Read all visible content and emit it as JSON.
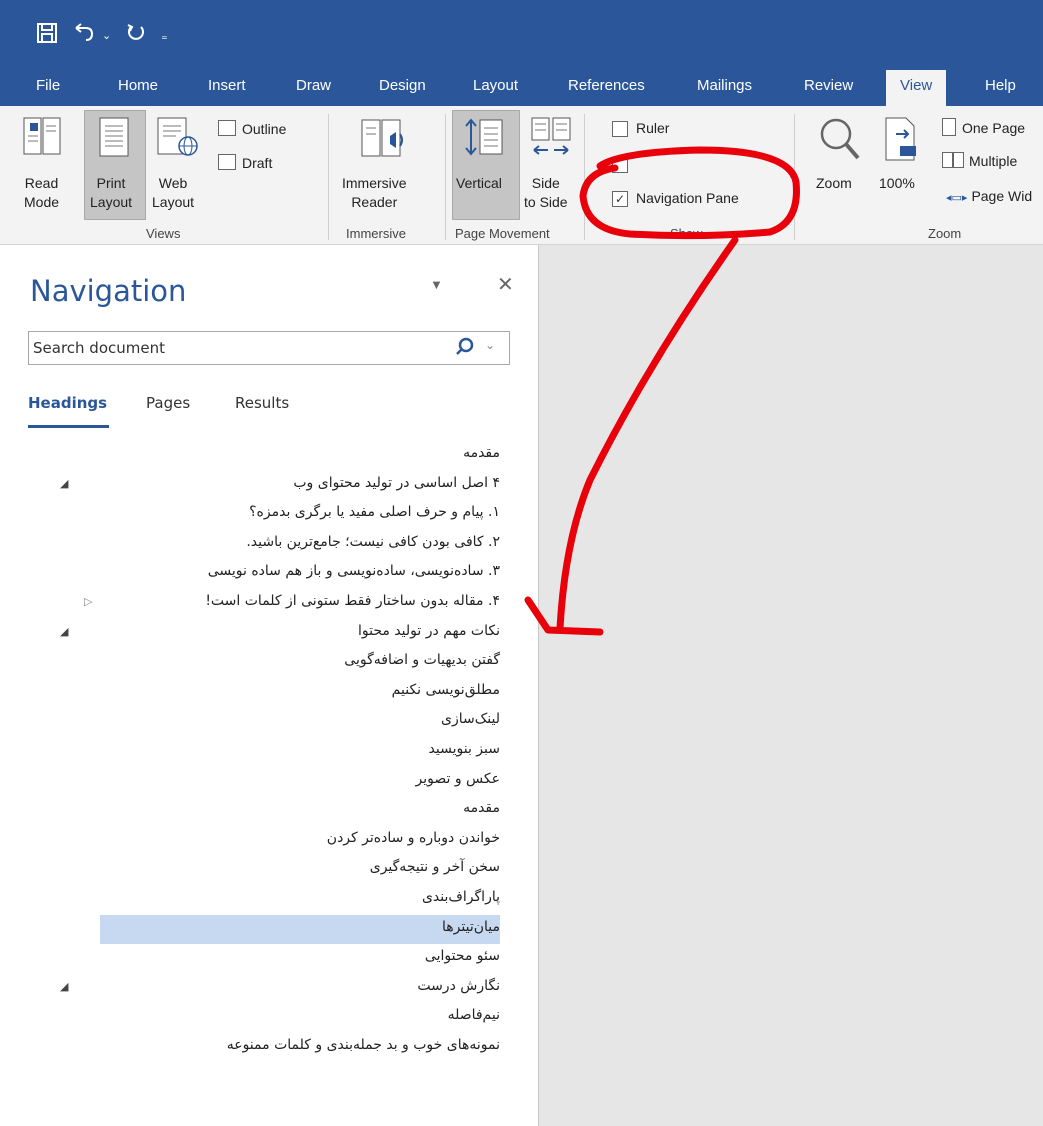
{
  "qat": {
    "save_icon": "save-icon",
    "undo_icon": "undo-icon",
    "redo_icon": "redo-icon",
    "customize_icon": "customize-qat-icon"
  },
  "tabs": [
    "File",
    "Home",
    "Insert",
    "Draw",
    "Design",
    "Layout",
    "References",
    "Mailings",
    "Review",
    "View",
    "Help"
  ],
  "active_tab": "View",
  "ribbon": {
    "views": {
      "read_mode": [
        "Read",
        "Mode"
      ],
      "print_layout": [
        "Print",
        "Layout"
      ],
      "web_layout": [
        "Web",
        "Layout"
      ],
      "outline": "Outline",
      "draft": "Draft",
      "group": "Views"
    },
    "immersive": {
      "reader": [
        "Immersive",
        "Reader"
      ],
      "group": "Immersive"
    },
    "page_movement": {
      "vertical": "Vertical",
      "side_to_side": [
        "Side",
        "to Side"
      ],
      "group": "Page Movement"
    },
    "show": {
      "ruler": "Ruler",
      "ruler_checked": false,
      "gridlines_checked": false,
      "navigation_pane": "Navigation Pane",
      "navigation_pane_checked": true,
      "group": "Show"
    },
    "zoom": {
      "zoom": "Zoom",
      "percent": "100%",
      "one_page": "One Page",
      "multiple": "Multiple",
      "page_width": "Page Wid",
      "group": "Zoom"
    }
  },
  "navigation": {
    "title": "Navigation",
    "search_placeholder": "Search document",
    "tabs": [
      "Headings",
      "Pages",
      "Results"
    ],
    "active_tab": "Headings",
    "headings": [
      {
        "text": "مقدمه",
        "caret": ""
      },
      {
        "text": "۴ اصل اساسی در تولید محتوای وب",
        "caret": "expanded"
      },
      {
        "text": "۱. پیام و حرف اصلی مفید یا برگری بدمزه؟",
        "caret": ""
      },
      {
        "text": "۲. کافی بودن کافی نیست؛ جامع‌ترین باشید.",
        "caret": ""
      },
      {
        "text": "۳. ساده‌نویسی، ساده‌نویسی و باز هم ساده نویسی",
        "caret": ""
      },
      {
        "text": "۴. مقاله بدون ساختار فقط ستونی از کلمات است!",
        "caret": "collapsed"
      },
      {
        "text": "نکات مهم در تولید محتوا",
        "caret": "expanded"
      },
      {
        "text": "گفتن بدیهیات و اضافه‌گویی",
        "caret": ""
      },
      {
        "text": "مطلق‌نویسی نکنیم",
        "caret": ""
      },
      {
        "text": "لینک‌سازی",
        "caret": ""
      },
      {
        "text": "سبز بنویسید",
        "caret": ""
      },
      {
        "text": "عکس و تصویر",
        "caret": ""
      },
      {
        "text": "مقدمه",
        "caret": ""
      },
      {
        "text": "خواندن دوباره و ساده‌تر کردن",
        "caret": ""
      },
      {
        "text": "سخن آخر و نتیجه‌گیری",
        "caret": ""
      },
      {
        "text": "پاراگراف‌بندی",
        "caret": ""
      },
      {
        "text": "میان‌تیترها",
        "caret": "",
        "selected": true
      },
      {
        "text": "سئو محتوایی",
        "caret": ""
      },
      {
        "text": "نگارش درست",
        "caret": "expanded"
      },
      {
        "text": "نیم‌فاصله",
        "caret": ""
      },
      {
        "text": "نمونه‌های خوب و بد جمله‌بندی و کلمات ممنوعه",
        "caret": ""
      }
    ]
  },
  "colors": {
    "accent": "#2b579a",
    "annotation": "#e8000a",
    "selection": "#c7d9f0"
  }
}
